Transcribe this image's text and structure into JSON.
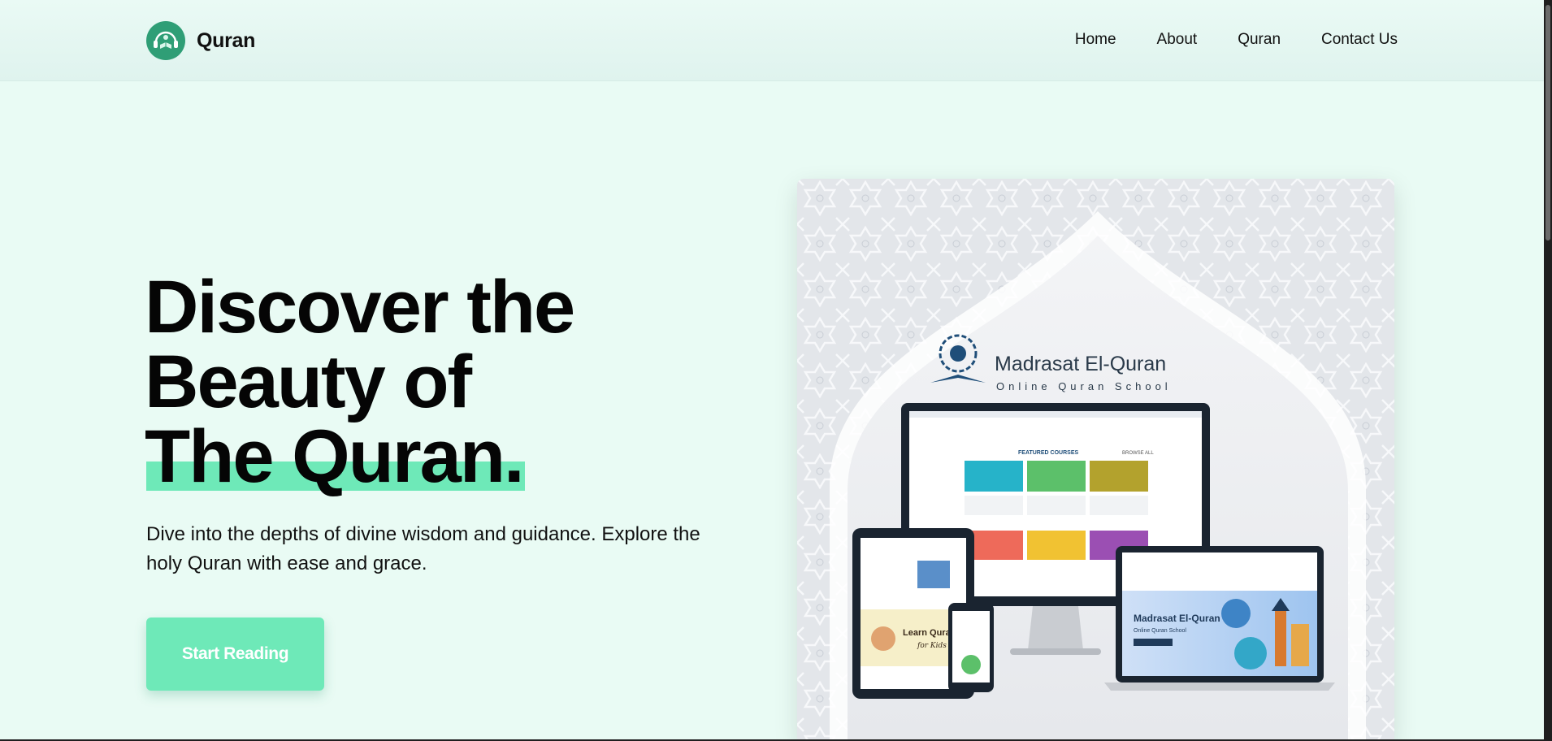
{
  "brand": {
    "name": "Quran",
    "logo_icon": "quran-headphones-logo"
  },
  "nav": {
    "items": [
      {
        "label": "Home"
      },
      {
        "label": "About"
      },
      {
        "label": "Quran"
      },
      {
        "label": "Contact Us"
      }
    ]
  },
  "hero": {
    "title_lines": [
      "Discover the",
      "Beauty of",
      "The Quran."
    ],
    "subtitle": "Dive into the depths of divine wisdom and guidance. Explore the holy Quran with ease and grace.",
    "cta_label": "Start Reading",
    "image": {
      "school_name": "Madrasat El-Quran",
      "school_tagline": "Online Quran School",
      "monitor_heading": "FEATURED COURSES",
      "monitor_link": "BROWSE ALL",
      "laptop_title": "Madrasat El-Quran",
      "laptop_subtitle": "Online Quran School",
      "tablet_banner": "Learn Quran",
      "tablet_banner_sub": "for Kids"
    }
  },
  "colors": {
    "page_bg": "#e9fbf4",
    "accent": "#6ee9b8",
    "logo_green": "#2f9e76",
    "text": "#050505"
  }
}
